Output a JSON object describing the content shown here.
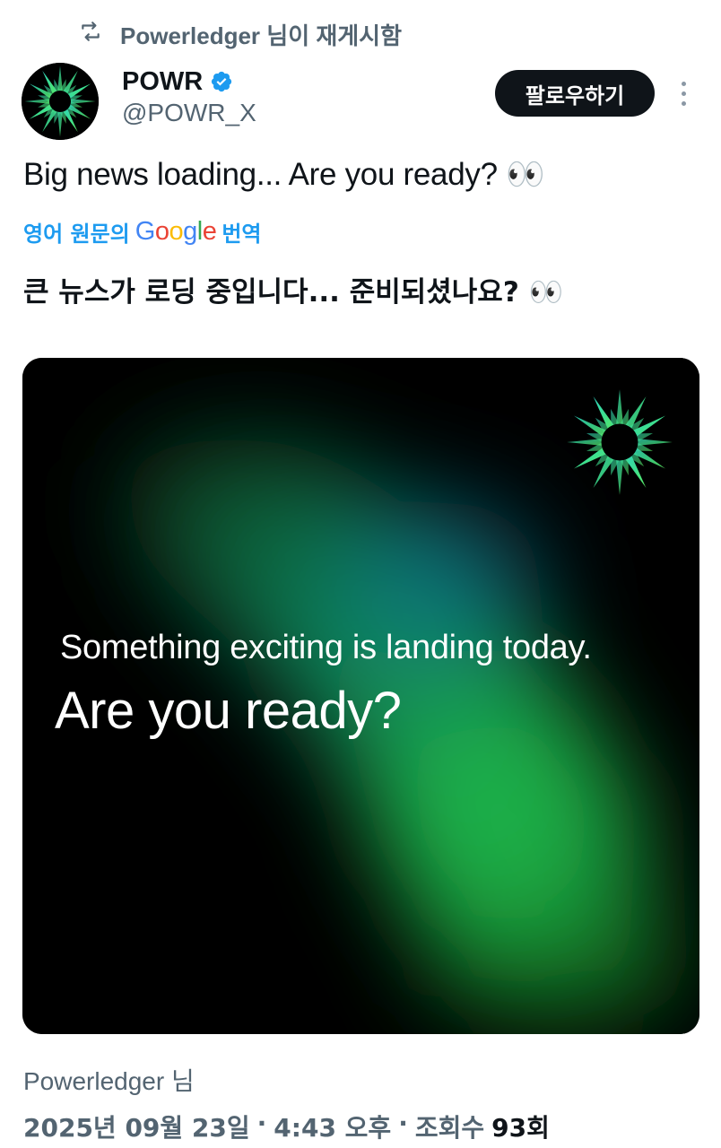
{
  "repost": {
    "icon": "repost-icon",
    "text": "Powerledger 님이 재게시함"
  },
  "author": {
    "display_name": "POWR",
    "handle": "@POWR_X",
    "verified_color": "#1d9bf0",
    "avatar_icon": "powr-logo-icon"
  },
  "follow_button": {
    "label": "팔로우하기"
  },
  "more_menu": {
    "icon": "more-vertical-icon"
  },
  "tweet": {
    "text": "Big news loading... Are you ready? 👀",
    "translation_prefix": "영어 원문의",
    "translation_brand": "Google",
    "translation_suffix": "번역",
    "translated_text": "큰 뉴스가 로딩 중입니다... 준비되셨나요? 👀"
  },
  "media": {
    "line1": "Something exciting is landing today.",
    "line2": "Are you ready?",
    "logo_icon": "powr-logo-icon"
  },
  "footer": {
    "attribution": "Powerledger 님",
    "date": "2025년 09월 23일",
    "sep1": "·",
    "time": "4:43 오후",
    "sep2": "·",
    "views_label": "조회수",
    "views_count": "93회"
  },
  "colors": {
    "accent": "#1d9bf0",
    "text_primary": "#0f1419",
    "text_secondary": "#536471",
    "logo_teal": "#2fd4c1",
    "logo_green": "#4ee66a"
  }
}
